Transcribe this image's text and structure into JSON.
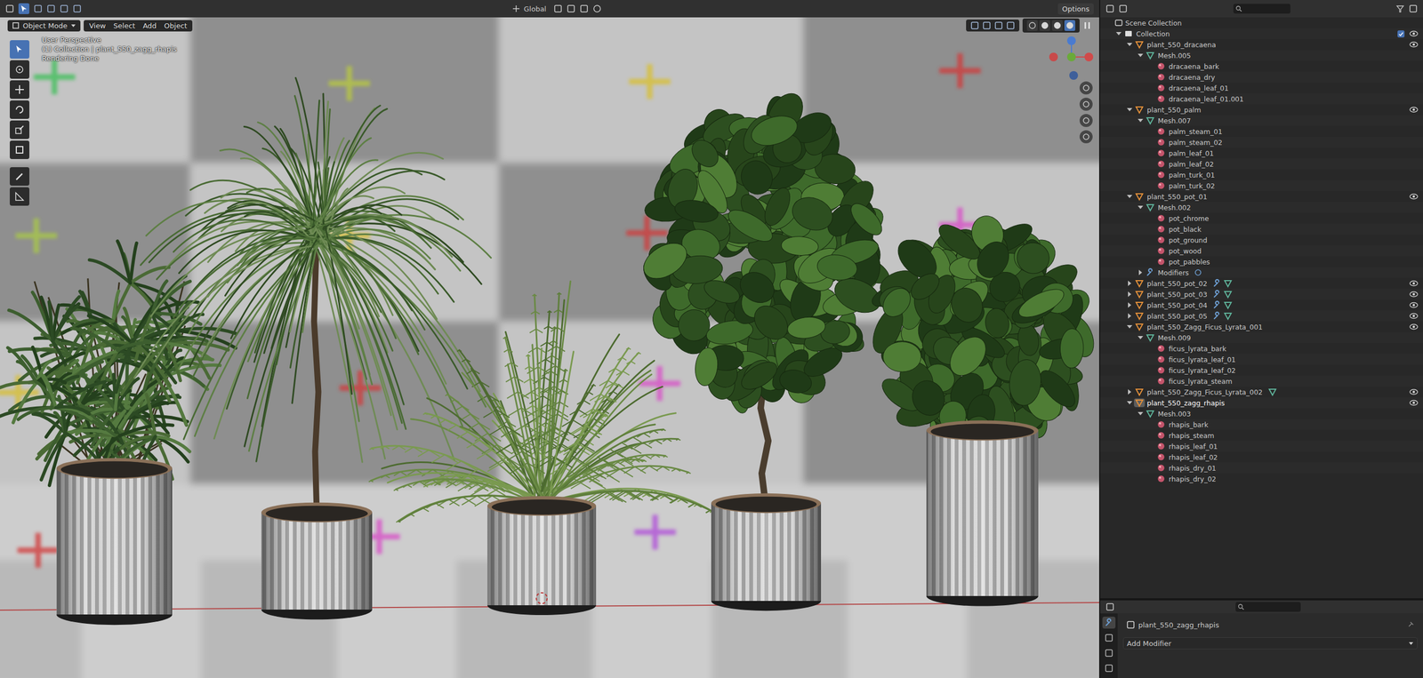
{
  "tool_settings": {
    "orientation": "Global",
    "options": "Options"
  },
  "header": {
    "mode": "Object Mode",
    "menus": [
      "View",
      "Select",
      "Add",
      "Object"
    ],
    "shading": [
      {
        "selected": false
      },
      {
        "selected": false
      },
      {
        "selected": false
      },
      {
        "selected": true
      }
    ]
  },
  "tools": [
    {
      "selected": true
    },
    {
      "selected": false
    },
    {
      "selected": false
    },
    {
      "selected": false
    },
    {
      "selected": false
    },
    {
      "selected": false
    },
    {
      "selected": false
    },
    {
      "selected": false
    }
  ],
  "viewport": {
    "info": [
      "User Perspective",
      "(1) Collection | plant_550_zagg_rhapis",
      "Rendering Done"
    ]
  },
  "outliner": {
    "root": "Scene Collection",
    "collection": {
      "label": "Collection",
      "expanded": true,
      "checked": true
    },
    "items": [
      {
        "label": "plant_550_dracaena",
        "kind": "object",
        "expanded": true,
        "eye": true,
        "selected": false,
        "hidden_children": 0
      },
      {
        "label": "Mesh.005",
        "kind": "mesh",
        "expanded": true
      },
      {
        "label": "dracaena_bark",
        "kind": "material"
      },
      {
        "label": "dracaena_dry",
        "kind": "material"
      },
      {
        "label": "dracaena_leaf_01",
        "kind": "material"
      },
      {
        "label": "dracaena_leaf_01.001",
        "kind": "material"
      },
      {
        "label": "plant_550_palm",
        "kind": "object",
        "expanded": true,
        "eye": true,
        "selected": false,
        "hidden_children": 0
      },
      {
        "label": "Mesh.007",
        "kind": "mesh",
        "expanded": true
      },
      {
        "label": "palm_steam_01",
        "kind": "material"
      },
      {
        "label": "palm_steam_02",
        "kind": "material"
      },
      {
        "label": "palm_leaf_01",
        "kind": "material"
      },
      {
        "label": "palm_leaf_02",
        "kind": "material"
      },
      {
        "label": "palm_turk_01",
        "kind": "material"
      },
      {
        "label": "palm_turk_02",
        "kind": "material"
      },
      {
        "label": "plant_550_pot_01",
        "kind": "object",
        "expanded": true,
        "eye": true,
        "selected": false,
        "hidden_children": 0
      },
      {
        "label": "Mesh.002",
        "kind": "mesh",
        "expanded": true
      },
      {
        "label": "pot_chrome",
        "kind": "material"
      },
      {
        "label": "pot_black",
        "kind": "material"
      },
      {
        "label": "pot_ground",
        "kind": "material"
      },
      {
        "label": "pot_wood",
        "kind": "material"
      },
      {
        "label": "pot_pabbles",
        "kind": "material"
      },
      {
        "label": "Modifiers",
        "kind": "modifiers",
        "expanded": false
      },
      {
        "label": "plant_550_pot_02",
        "kind": "object",
        "expanded": false,
        "eye": true,
        "selected": false,
        "hidden_children": 2
      },
      {
        "label": "plant_550_pot_03",
        "kind": "object",
        "expanded": false,
        "eye": true,
        "selected": false,
        "hidden_children": 2
      },
      {
        "label": "plant_550_pot_04",
        "kind": "object",
        "expanded": false,
        "eye": true,
        "selected": false,
        "hidden_children": 2
      },
      {
        "label": "plant_550_pot_05",
        "kind": "object",
        "expanded": false,
        "eye": true,
        "selected": false,
        "hidden_children": 2
      },
      {
        "label": "plant_550_Zagg_Ficus_Lyrata_001",
        "kind": "object",
        "expanded": true,
        "eye": true,
        "selected": false,
        "hidden_children": 0
      },
      {
        "label": "Mesh.009",
        "kind": "mesh",
        "expanded": true
      },
      {
        "label": "ficus_lyrata_bark",
        "kind": "material"
      },
      {
        "label": "ficus_lyrata_leaf_01",
        "kind": "material"
      },
      {
        "label": "ficus_lyrata_leaf_02",
        "kind": "material"
      },
      {
        "label": "ficus_lyrata_steam",
        "kind": "material"
      },
      {
        "label": "plant_550_Zagg_Ficus_Lyrata_002",
        "kind": "object",
        "expanded": false,
        "eye": true,
        "selected": false,
        "hidden_children": 1
      },
      {
        "label": "plant_550_zagg_rhapis",
        "kind": "object",
        "expanded": true,
        "eye": true,
        "selected": true,
        "hidden_children": 0
      },
      {
        "label": "Mesh.003",
        "kind": "mesh",
        "expanded": true
      },
      {
        "label": "rhapis_bark",
        "kind": "material"
      },
      {
        "label": "rhapis_steam",
        "kind": "material"
      },
      {
        "label": "rhapis_leaf_01",
        "kind": "material"
      },
      {
        "label": "rhapis_leaf_02",
        "kind": "material"
      },
      {
        "label": "rhapis_dry_01",
        "kind": "material"
      },
      {
        "label": "rhapis_dry_02",
        "kind": "material"
      }
    ]
  },
  "properties": {
    "tabs": [
      {
        "selected": true
      },
      {
        "selected": false
      },
      {
        "selected": false
      },
      {
        "selected": false
      }
    ],
    "object": "plant_550_zagg_rhapis",
    "add_modifier": "Add Modifier"
  }
}
